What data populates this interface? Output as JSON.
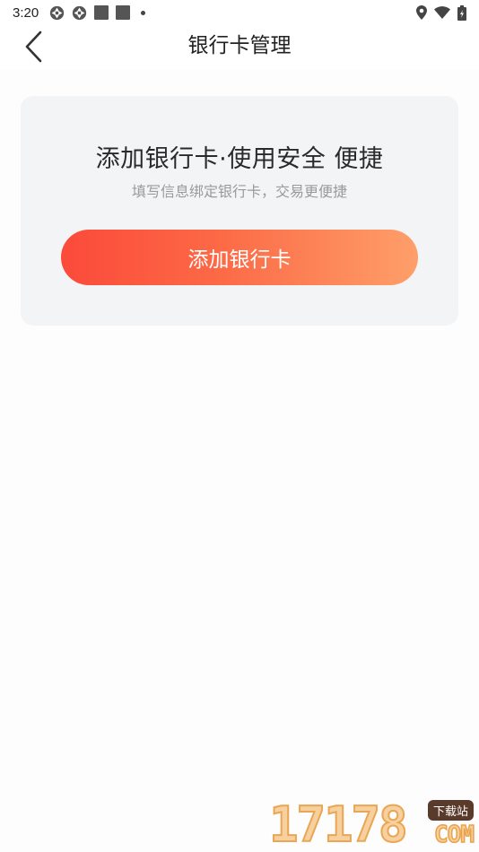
{
  "status_bar": {
    "time": "3:20",
    "left_icons": [
      "shutter-icon",
      "shutter-icon",
      "notification-square-icon",
      "notification-square-icon",
      "dot-icon"
    ],
    "right_icons": [
      "location-icon",
      "wifi-icon",
      "battery-icon"
    ]
  },
  "header": {
    "back_icon": "chevron-left-icon",
    "title": "银行卡管理"
  },
  "card": {
    "title": "添加银行卡·使用安全 便捷",
    "subtitle": "填写信息绑定银行卡，交易更便捷",
    "button_label": "添加银行卡",
    "button_gradient": [
      "#fb4a3a",
      "#fe9f6a"
    ]
  },
  "watermark": {
    "digits": "17178",
    "badge": "下载站",
    "suffix": "COM"
  }
}
